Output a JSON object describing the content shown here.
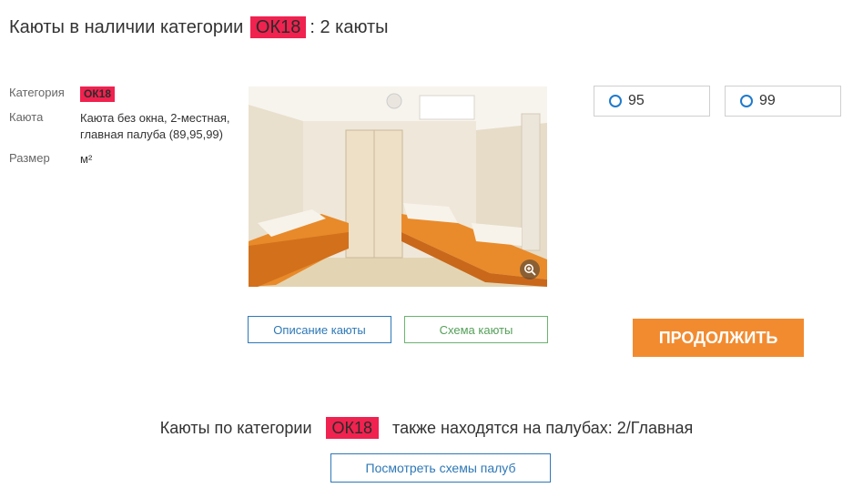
{
  "header": {
    "title_prefix": "Каюты в наличии категории",
    "category_badge": "ОК18",
    "title_suffix": ": 2 каюты"
  },
  "details": {
    "category_label": "Категория",
    "category_value": "ОК18",
    "cabin_label": "Каюта",
    "cabin_value_line1": "Каюта без окна, 2-местная,",
    "cabin_value_line2": "главная палуба (89,95,99)",
    "size_label": "Размер",
    "size_value": "м²"
  },
  "cabins": [
    {
      "number": "95",
      "selected": false
    },
    {
      "number": "99",
      "selected": false
    }
  ],
  "buttons": {
    "description": "Описание каюты",
    "scheme": "Схема каюты",
    "continue": "ПРОДОЛЖИТЬ",
    "deck_schemes": "Посмотреть схемы палуб"
  },
  "deck_info": {
    "prefix": "Каюты по категории",
    "category_badge": "ОК18",
    "suffix": "также находятся на палубах: 2/Главная"
  },
  "colors": {
    "badge": "#f0224f",
    "primary_blue": "#2e78b7",
    "green": "#6bb26f",
    "continue": "#f28b30"
  },
  "icons": [
    "zoom-in-icon",
    "radio-icon"
  ]
}
